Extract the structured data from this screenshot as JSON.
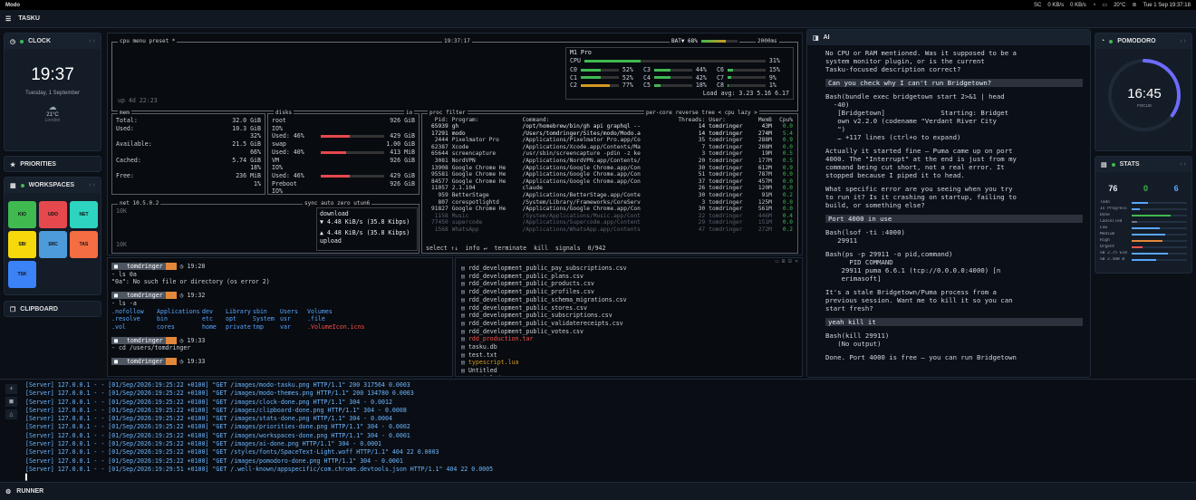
{
  "menubar": {
    "app": "Modo",
    "status": [
      "SC",
      "0 KB/s",
      "0 KB/s",
      "20°C",
      "Tue 1 Sep 19:37:18"
    ]
  },
  "title": "TASKU",
  "clock": {
    "title": "CLOCK",
    "time": "19:37",
    "date": "Tuesday, 1 September",
    "temp": "21°C",
    "place": "London"
  },
  "priorities": {
    "title": "PRIORITIES"
  },
  "workspaces": {
    "title": "WORKSPACES",
    "items": [
      {
        "label": "KIO",
        "color": "#3fb950"
      },
      {
        "label": "UDO",
        "color": "#e5484d"
      },
      {
        "label": "NET",
        "color": "#2dd4bf"
      },
      {
        "label": "SBI",
        "color": "#f5d90a"
      },
      {
        "label": "SRC",
        "color": "#4d9bdb"
      },
      {
        "label": "TAS",
        "color": "#f46d43"
      },
      {
        "label": "TSK",
        "color": "#3b82f6"
      }
    ]
  },
  "clipboard": {
    "title": "CLIPBOARD"
  },
  "btop": {
    "header": {
      "left": "cpu  menu  preset *",
      "time": "19:37:17",
      "bat": "BAT▼ 68%",
      "ms": "2000ms"
    },
    "uptime": "up 4d 22:23",
    "cpu_model": "M1 Pro",
    "cpu_total": "31%",
    "cores": [
      {
        "n": "C0",
        "v": "52%"
      },
      {
        "n": "C3",
        "v": "44%"
      },
      {
        "n": "C6",
        "v": "15%"
      },
      {
        "n": "C1",
        "v": "52%"
      },
      {
        "n": "C4",
        "v": "42%"
      },
      {
        "n": "C7",
        "v": "9%"
      },
      {
        "n": "C2",
        "v": "77%"
      },
      {
        "n": "C5",
        "v": "18%"
      },
      {
        "n": "C8",
        "v": "1%"
      }
    ],
    "load": "Load avg: 3.23 5.16 6.17",
    "mem": {
      "title": "mem",
      "rows": [
        [
          "Total:",
          "32.0 GiB"
        ],
        [
          "Used:",
          "10.3 GiB"
        ],
        [
          "",
          "32%"
        ],
        [
          "Available:",
          "21.5 GiB"
        ],
        [
          "",
          "66%"
        ],
        [
          "Cached:",
          "5.74 GiB"
        ],
        [
          "",
          "18%"
        ],
        [
          "Free:",
          "236 MiB"
        ],
        [
          "",
          "1%"
        ]
      ]
    },
    "disks": {
      "title": "disks",
      "io": "io",
      "rows": [
        [
          "root",
          "926 GiB"
        ],
        [
          "IO%",
          ""
        ],
        [
          "Used: 46%",
          "429 GiB"
        ],
        [
          "swap",
          "1.00 GiB"
        ],
        [
          "Used: 40%",
          "413 MiB"
        ],
        [
          "VM",
          "926 GiB"
        ],
        [
          "IO%",
          ""
        ],
        [
          "Used: 46%",
          "429 GiB"
        ],
        [
          "Preboot",
          "926 GiB"
        ],
        [
          "IO%",
          ""
        ]
      ]
    },
    "net": {
      "title": "net",
      "iface": "10.5.0.2",
      "sync": "sync",
      "auto": "auto",
      "zero": "zero",
      "dev": "utun6",
      "down": "▼ 4.48 KiB/s (35.8 Kibps)",
      "down_lbl": "download",
      "up": "▲ 4.48 KiB/s (35.8 Kibps)",
      "up_lbl": "upload",
      "scale_hi": "10K",
      "scale_lo": "10K"
    },
    "proc": {
      "title": "proc",
      "filter": "filter",
      "opts": "per-core  reverse  tree  < cpu lazy >",
      "cols": [
        "Pid:",
        "Program:",
        "Command:",
        "Threads:",
        "User:",
        "MemB",
        "Cpu%"
      ],
      "rows": [
        [
          "65939",
          "gh",
          "/opt/homebrew/bin/gh api graphql --",
          "14",
          "tomdringer",
          "43M",
          "0.0"
        ],
        [
          "17291",
          "modo",
          "/Users/tomdringer/Sites/modo/Modo.a",
          "14",
          "tomdringer",
          "274M",
          "5.4"
        ],
        [
          "2444",
          "Pixelmator Pro",
          "/Applications/Pixelmator Pro.app/Co",
          "35",
          "tomdringer",
          "288M",
          "0.9"
        ],
        [
          "62387",
          "Xcode",
          "/Applications/Xcode.app/Contents/Ma",
          "7",
          "tomdringer",
          "208M",
          "0.0"
        ],
        [
          "65644",
          "screencapture",
          "/usr/sbin/screencapture -pdin -z ke",
          "3",
          "tomdringer",
          "19M",
          "0.5"
        ],
        [
          "3081",
          "NordVPN",
          "/Applications/NordVPN.app/Contents/",
          "20",
          "tomdringer",
          "177M",
          "0.5"
        ],
        [
          "13908",
          "Google Chrome He",
          "/Applications/Google Chrome.app/Con",
          "30",
          "tomdringer",
          "612M",
          "0.9"
        ],
        [
          "95581",
          "Google Chrome He",
          "/Applications/Google Chrome.app/Con",
          "51",
          "tomdringer",
          "787M",
          "0.0"
        ],
        [
          "84577",
          "Google Chrome He",
          "/Applications/Google Chrome.app/Con",
          "37",
          "tomdringer",
          "457M",
          "0.0"
        ],
        [
          "11057",
          "2.1.104",
          "claude",
          "26",
          "tomdringer",
          "120M",
          "0.0"
        ],
        [
          "959",
          "BetterStage",
          "/Applications/BetterStage.app/Conte",
          "30",
          "tomdringer",
          "91M",
          "0.2"
        ],
        [
          "807",
          "corespotlightd",
          "/System/Library/Frameworks/CoreServ",
          "3",
          "tomdringer",
          "125M",
          "0.0"
        ],
        [
          "91827",
          "Google Chrome He",
          "/Applications/Google Chrome.app/Con",
          "30",
          "tomdringer",
          "561M",
          "0.0"
        ],
        [
          "1158",
          "Music",
          "/System/Applications/Music.app/Cont",
          "22",
          "tomdringer",
          "446M",
          "0.4"
        ],
        [
          "77450",
          "supercode",
          "/Applications/Supercode.app/Content",
          "29",
          "tomdringer",
          "151M",
          "0.0"
        ],
        [
          "1568",
          "WhatsApp",
          "/Applications/WhatsApp.app/Contents",
          "47",
          "tomdringer",
          "272M",
          "0.2"
        ]
      ],
      "footer": "select ↑↓  info ↵  terminate  kill  signals  0/942"
    }
  },
  "shell": {
    "blocks": [
      {
        "user": "tomdringer",
        "time": "19:28",
        "lines": [
          "- ls 0a",
          "\"0a\": No such file or directory (os error 2)"
        ]
      },
      {
        "user": "tomdringer",
        "time": "19:32",
        "lines": [
          "- ls -a"
        ],
        "ls": [
          [
            ".nofollow",
            "Applications",
            "dev",
            "Library",
            "sbin",
            "Users",
            "Volumes"
          ],
          [
            ".resolve",
            "bin",
            "etc",
            "opt",
            "System",
            "usr",
            ".file"
          ],
          [
            ".vol",
            "cores",
            "home",
            "private",
            "tmp",
            "var",
            ".VolumeIcon.icns"
          ]
        ]
      },
      {
        "user": "tomdringer",
        "time": "19:33",
        "lines": [
          "- cd /users/tomdringer"
        ]
      },
      {
        "user": "tomdringer",
        "time": "19:33",
        "lines": []
      }
    ]
  },
  "files": [
    "rdd_development_public_pay_subscriptions.csv",
    "rdd_development_public_plans.csv",
    "rdd_development_public_products.csv",
    "rdd_development_public_profiles.csv",
    "rdd_development_public_schema_migrations.csv",
    "rdd_development_public_stores.csv",
    "rdd_development_public_subscriptions.csv",
    "rdd_development_public_validatereceipts.csv",
    "rdd_development_public_votes.csv",
    "rdd_production.tar",
    "tasku.db",
    "test.txt",
    "typescript.lua",
    "Untitled",
    "'Untitled 6.txt'"
  ],
  "ai": {
    "title": "AI",
    "messages": [
      {
        "t": "p",
        "text": "No CPU or RAM mentioned. Was it supposed to be a\nsystem monitor plugin, or is the current\nTasku-focused description correct?"
      },
      {
        "t": "q",
        "text": "Can you check why I can't run Bridgetown?"
      },
      {
        "t": "p",
        "text": "Bash(bundle exec bridgetown start 2>&1 | head\n  -40)\n   [Bridgetown]              Starting: Bridget\n   own v2.2.0 (codename \"Verdant River City\n   \")\n   … +117 lines (ctrl+o to expand)"
      },
      {
        "t": "p",
        "text": "Actually it started fine — Puma came up on port\n4000. The \"Interrupt\" at the end is just from my\ncommand being cut short, not a real error. It\nstopped because I piped it to head."
      },
      {
        "t": "p",
        "text": "What specific error are you seeing when you try\nto run it? Is it crashing on startup, failing to\nbuild, or something else?"
      },
      {
        "t": "q",
        "text": "Port 4000 in use"
      },
      {
        "t": "p",
        "text": "Bash(lsof -ti :4000)\n   29911"
      },
      {
        "t": "p",
        "text": "Bash(ps -p 29911 -o pid,command)\n      PID COMMAND\n    29911 puma 6.6.1 (tcp://0.0.0.0:4000) [n\n    erimasoft]"
      },
      {
        "t": "p",
        "text": "It's a stale Bridgetown/Puma process from a\nprevious session. Want me to kill it so you can\nstart fresh?"
      },
      {
        "t": "q",
        "text": "yeah kill it"
      },
      {
        "t": "p",
        "text": "Bash(kill 29911)\n   (No output)"
      },
      {
        "t": "p",
        "text": "Done. Port 4000 is free — you can run Bridgetown"
      }
    ]
  },
  "pomodoro": {
    "title": "POMODORO",
    "time": "16:45",
    "label": "FOCUS",
    "progress": 0.35
  },
  "stats": {
    "title": "STATS",
    "nums": [
      {
        "v": "76",
        "c": "#e6edf3"
      },
      {
        "v": "0",
        "c": "#3fb950"
      },
      {
        "v": "6",
        "c": "#58a6ff"
      }
    ],
    "rows": [
      {
        "n": "Todo",
        "v": 0.3,
        "c": "#58a6ff"
      },
      {
        "n": "In Progress",
        "v": 0.15,
        "c": "#58a6ff"
      },
      {
        "n": "Done",
        "v": 0.7,
        "c": "#3fb950"
      },
      {
        "n": "Cancelled",
        "v": 0.1,
        "c": "#6e7681"
      },
      {
        "n": "Low",
        "v": 0.5,
        "c": "#58a6ff"
      },
      {
        "n": "Medium",
        "v": 0.6,
        "c": "#58a6ff"
      },
      {
        "n": "High",
        "v": 0.55,
        "c": "#e3883a"
      },
      {
        "n": "Urgent",
        "v": 0.2,
        "c": "#f85149"
      },
      {
        "n": "SB 2.75 GiB",
        "v": 0.65,
        "c": "#58a6ff"
      },
      {
        "n": "SB 2.500 B",
        "v": 0.45,
        "c": "#58a6ff"
      }
    ]
  },
  "runner": {
    "title": "RUNNER",
    "log": [
      "[Server] 127.0.0.1 - - [01/Sep/2026:19:25:22 +0100] \"GET /images/modo-tasku.png HTTP/1.1\" 200 317564 0.0003",
      "[Server] 127.0.0.1 - - [01/Sep/2026:19:25:22 +0100] \"GET /images/modo-themes.png HTTP/1.1\" 200 134780 0.0003",
      "[Server] 127.0.0.1 - - [01/Sep/2026:19:25:22 +0100] \"GET /images/clock-done.png HTTP/1.1\" 304 - 0.0012",
      "[Server] 127.0.0.1 - - [01/Sep/2026:19:25:22 +0100] \"GET /images/clipboard-done.png HTTP/1.1\" 304 - 0.0008",
      "[Server] 127.0.0.1 - - [01/Sep/2026:19:25:22 +0100] \"GET /images/stats-done.png HTTP/1.1\" 304 - 0.0004",
      "[Server] 127.0.0.1 - - [01/Sep/2026:19:25:22 +0100] \"GET /images/priorities-done.png HTTP/1.1\" 304 - 0.0002",
      "[Server] 127.0.0.1 - - [01/Sep/2026:19:25:22 +0100] \"GET /images/workspaces-done.png HTTP/1.1\" 304 - 0.0001",
      "[Server] 127.0.0.1 - - [01/Sep/2026:19:25:22 +0100] \"GET /images/ai-done.png HTTP/1.1\" 304 - 0.0001",
      "[Server] 127.0.0.1 - - [01/Sep/2026:19:25:22 +0100] \"GET /styles/fonts/SpaceText-Light.woff HTTP/1.1\" 404 22 0.0003",
      "[Server] 127.0.0.1 - - [01/Sep/2026:19:25:22 +0100] \"GET /images/pomodoro-done.png HTTP/1.1\" 304 - 0.0001",
      "[Server] 127.0.0.1 - - [01/Sep/2026:19:29:51 +0100] \"GET /.well-known/appspecific/com.chrome.devtools.json HTTP/1.1\" 404 22 0.0005"
    ]
  }
}
